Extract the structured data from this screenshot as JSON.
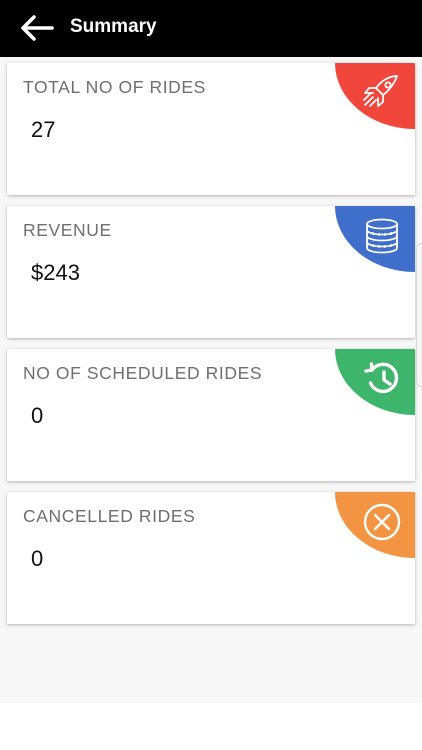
{
  "header": {
    "title": "Summary",
    "back_icon": "arrow-left-icon",
    "background": "#000000"
  },
  "cards": [
    {
      "label": "TOTAL NO OF RIDES",
      "value": "27",
      "icon": "rocket-icon",
      "color": "#f1463b"
    },
    {
      "label": "REVENUE",
      "value": "$243",
      "icon": "coins-icon",
      "color": "#3f6fcb"
    },
    {
      "label": "NO OF SCHEDULED RIDES",
      "value": "0",
      "icon": "history-icon",
      "color": "#3db56a"
    },
    {
      "label": "CANCELLED RIDES",
      "value": "0",
      "icon": "cancel-circle-icon",
      "color": "#f39443"
    }
  ]
}
